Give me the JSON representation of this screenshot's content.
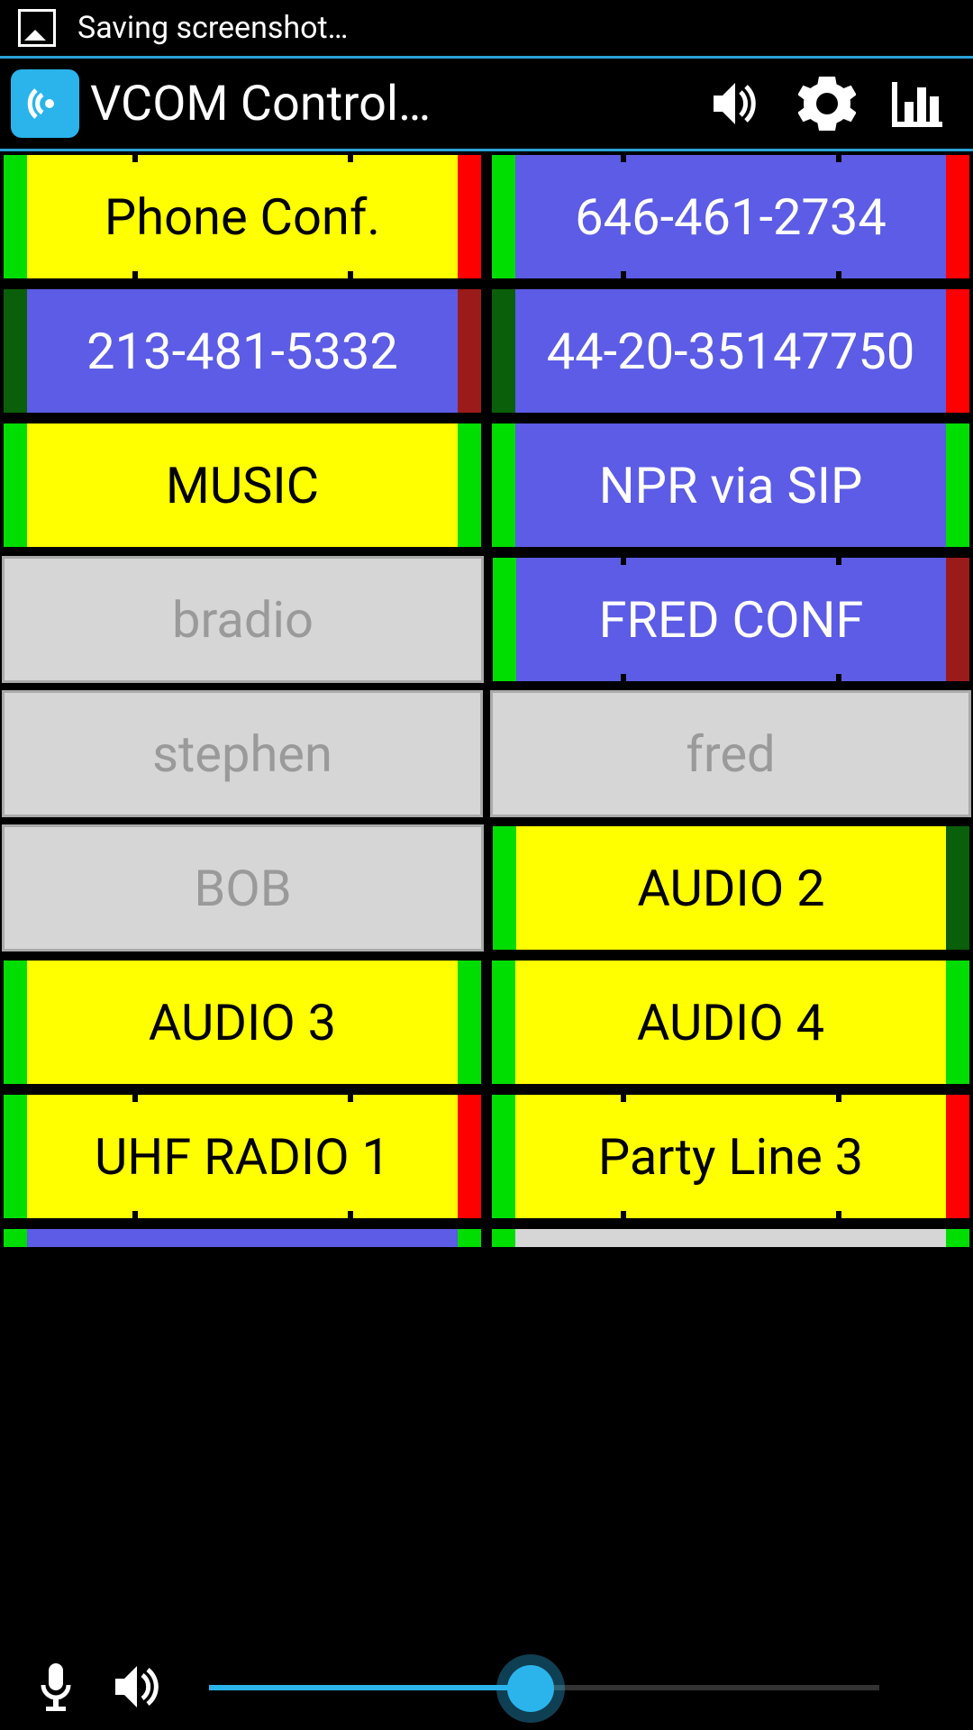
{
  "statusbar": {
    "text": "Saving screenshot…"
  },
  "appbar": {
    "title": "VCOM Control…"
  },
  "channels": [
    [
      {
        "label": "Phone Conf.",
        "mid": "yellow",
        "txt": "black",
        "l": "green",
        "r": "red",
        "ticks": true
      },
      {
        "label": "646-461-2734",
        "mid": "blue",
        "txt": "white",
        "l": "green",
        "r": "red",
        "ticks": true
      }
    ],
    [
      {
        "label": "213-481-5332",
        "mid": "blue",
        "txt": "white",
        "l": "dgreen",
        "r": "dred",
        "ticks": false
      },
      {
        "label": "44-20-35147750",
        "mid": "blue",
        "txt": "white",
        "l": "dgreen",
        "r": "red",
        "ticks": false
      }
    ],
    [
      {
        "label": "MUSIC",
        "mid": "yellow",
        "txt": "black",
        "l": "green",
        "r": "green",
        "ticks": false
      },
      {
        "label": "NPR via SIP",
        "mid": "blue",
        "txt": "white",
        "l": "green",
        "r": "green",
        "ticks": false
      }
    ],
    [
      {
        "label": "bradio",
        "inactive": true
      },
      {
        "label": "FRED CONF",
        "mid": "blue",
        "txt": "white",
        "l": "green",
        "r": "dred",
        "ticks": true
      }
    ],
    [
      {
        "label": "stephen",
        "inactive": true
      },
      {
        "label": "fred",
        "inactive": true
      }
    ],
    [
      {
        "label": "BOB",
        "inactive": true
      },
      {
        "label": "AUDIO 2",
        "mid": "yellow",
        "txt": "black",
        "l": "green",
        "r": "dgreen",
        "ticks": false
      }
    ],
    [
      {
        "label": "AUDIO 3",
        "mid": "yellow",
        "txt": "black",
        "l": "green",
        "r": "green",
        "ticks": false
      },
      {
        "label": "AUDIO 4",
        "mid": "yellow",
        "txt": "black",
        "l": "green",
        "r": "green",
        "ticks": false
      }
    ],
    [
      {
        "label": "UHF RADIO 1",
        "mid": "yellow",
        "txt": "black",
        "l": "green",
        "r": "red",
        "ticks": true
      },
      {
        "label": "Party Line 3",
        "mid": "yellow",
        "txt": "black",
        "l": "green",
        "r": "red",
        "ticks": true
      }
    ]
  ],
  "slider": {
    "percent": 48
  }
}
